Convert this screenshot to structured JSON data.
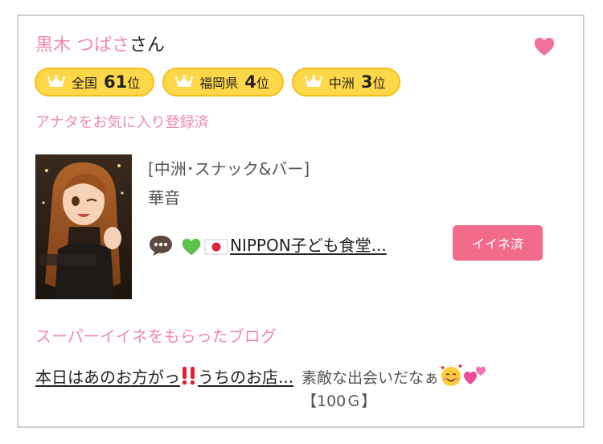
{
  "user": {
    "name": "黒木 つばさ",
    "suffix": "さん"
  },
  "rankings": [
    {
      "area": "全国",
      "rank": "61",
      "unit": "位"
    },
    {
      "area": "福岡県",
      "rank": "4",
      "unit": "位"
    },
    {
      "area": "中洲",
      "rank": "3",
      "unit": "位"
    }
  ],
  "favorite_status": "アナタをお気に入り登録済",
  "shop": {
    "category": "[中洲･スナック&バー]",
    "name": "華音"
  },
  "post": {
    "title": "NIPPON子ども食堂..."
  },
  "like_button": "イイネ済",
  "super_like": {
    "label": "スーパーイイネをもらったブログ",
    "blog_title_part1": "本日はあのお方がっ",
    "blog_title_part2": "うちのお店...",
    "comment": "素敵な出会いだなぁ",
    "reward": "【100Ｇ】"
  },
  "icons": {
    "heart": "heart-icon",
    "crown": "crown-icon",
    "speech": "speech-bubble-icon",
    "green_heart": "green-heart-icon",
    "japan_flag": "japan-flag-icon",
    "double_exclamation": "double-exclamation-icon",
    "smiling_hearts": "smiling-face-hearts-icon",
    "two_hearts": "two-hearts-icon"
  },
  "colors": {
    "pink_text": "#ef8ab2",
    "badge_fill": "#ffd84a",
    "badge_border": "#f4bd1c",
    "like_button": "#f36b8a",
    "heart": "#f0719a"
  }
}
